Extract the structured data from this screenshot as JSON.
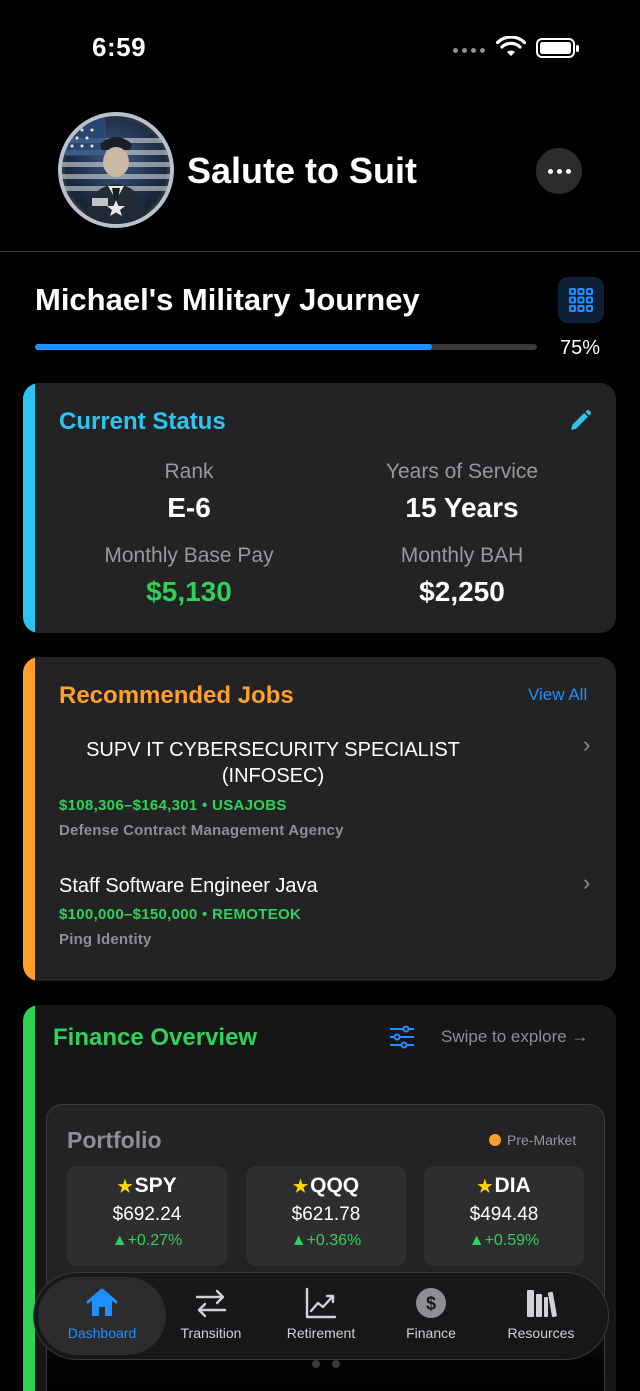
{
  "status_bar": {
    "time": "6:59"
  },
  "header": {
    "app_title": "Salute to Suit"
  },
  "journey": {
    "title": "Michael's Military Journey",
    "progress_label": "75%",
    "progress": 0.75
  },
  "current_status": {
    "title": "Current Status",
    "rank_label": "Rank",
    "rank_value": "E-6",
    "years_label": "Years of Service",
    "years_value": "15 Years",
    "pay_label": "Monthly Base Pay",
    "pay_value": "$5,130",
    "bah_label": "Monthly BAH",
    "bah_value": "$2,250"
  },
  "jobs": {
    "title": "Recommended Jobs",
    "view_all": "View All",
    "items": [
      {
        "title": "SUPV IT CYBERSECURITY SPECIALIST (INFOSEC)",
        "salary": "$108,306–$164,301 • USAJOBS",
        "agency": "Defense Contract Management Agency"
      },
      {
        "title": "Staff Software Engineer Java",
        "salary": "$100,000–$150,000 • REMOTEOK",
        "agency": "Ping Identity"
      }
    ]
  },
  "finance": {
    "title": "Finance Overview",
    "swipe_hint": "Swipe to explore →",
    "portfolio_title": "Portfolio",
    "market_status": "Pre-Market",
    "tickers": [
      {
        "symbol": "SPY",
        "price": "$692.24",
        "change": "+0.27%"
      },
      {
        "symbol": "QQQ",
        "price": "$621.78",
        "change": "+0.36%"
      },
      {
        "symbol": "DIA",
        "price": "$494.48",
        "change": "+0.59%"
      }
    ]
  },
  "tabbar": {
    "tabs": [
      {
        "label": "Dashboard",
        "icon": "house-icon"
      },
      {
        "label": "Transition",
        "icon": "arrows-icon"
      },
      {
        "label": "Retirement",
        "icon": "chart-icon"
      },
      {
        "label": "Finance",
        "icon": "dollar-icon"
      },
      {
        "label": "Resources",
        "icon": "books-icon"
      }
    ]
  },
  "colors": {
    "accent_blue": "#1e90ff",
    "status_cyan": "#2ec4f0",
    "jobs_orange": "#ff9f2e",
    "finance_green": "#30d158"
  }
}
